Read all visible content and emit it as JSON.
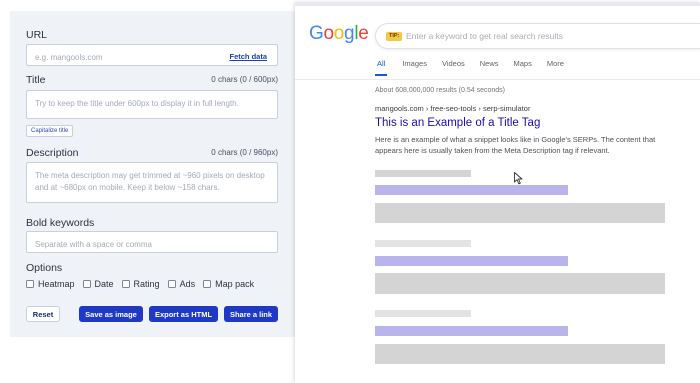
{
  "editor": {
    "url": {
      "label": "URL",
      "placeholder": "e.g. mangools.com",
      "fetch_label": "Fetch data"
    },
    "title": {
      "label": "Title",
      "count": "0 chars (0 / 600px)",
      "placeholder": "Try to keep the title under 600px to display it in full length.",
      "capitalize_label": "Capitalize title"
    },
    "description": {
      "label": "Description",
      "count": "0 chars (0 / 960px)",
      "placeholder": "The meta description may get trimmed at ~960 pixels on desktop and at ~680px on mobile. Keep it below ~158 chars."
    },
    "bold_keywords": {
      "label": "Bold keywords",
      "placeholder": "Separate with a space or comma"
    },
    "options": {
      "label": "Options",
      "items": [
        "Heatmap",
        "Date",
        "Rating",
        "Ads",
        "Map pack"
      ]
    },
    "buttons": {
      "reset": "Reset",
      "save_image": "Save as image",
      "export_html": "Export as HTML",
      "share_link": "Share a link"
    }
  },
  "serp": {
    "logo_letters": [
      "G",
      "o",
      "o",
      "g",
      "l",
      "e"
    ],
    "logo_colors": [
      "#4285f4",
      "#ea4335",
      "#fbbc05",
      "#4285f4",
      "#34a853",
      "#ea4335"
    ],
    "tip_label": "TIP:",
    "search_placeholder": "Enter a keyword to get real search results",
    "tabs": [
      "All",
      "Images",
      "Videos",
      "News",
      "Maps",
      "More"
    ],
    "results_count": "About 608,000,000 results (0.54 seconds)",
    "result": {
      "breadcrumb": "mangools.com › free-seo-tools › serp-simulator",
      "title": "This is an Example of a Title Tag",
      "snippet": "Here is an example of what a snippet looks like in Google's SERPs. The content that appears here is usually taken from the Meta Description tag if relevant."
    }
  },
  "colors": {
    "accent_blue": "#1f39c7",
    "link_title": "#1a0dab",
    "panel_bg": "#eff2f6"
  }
}
